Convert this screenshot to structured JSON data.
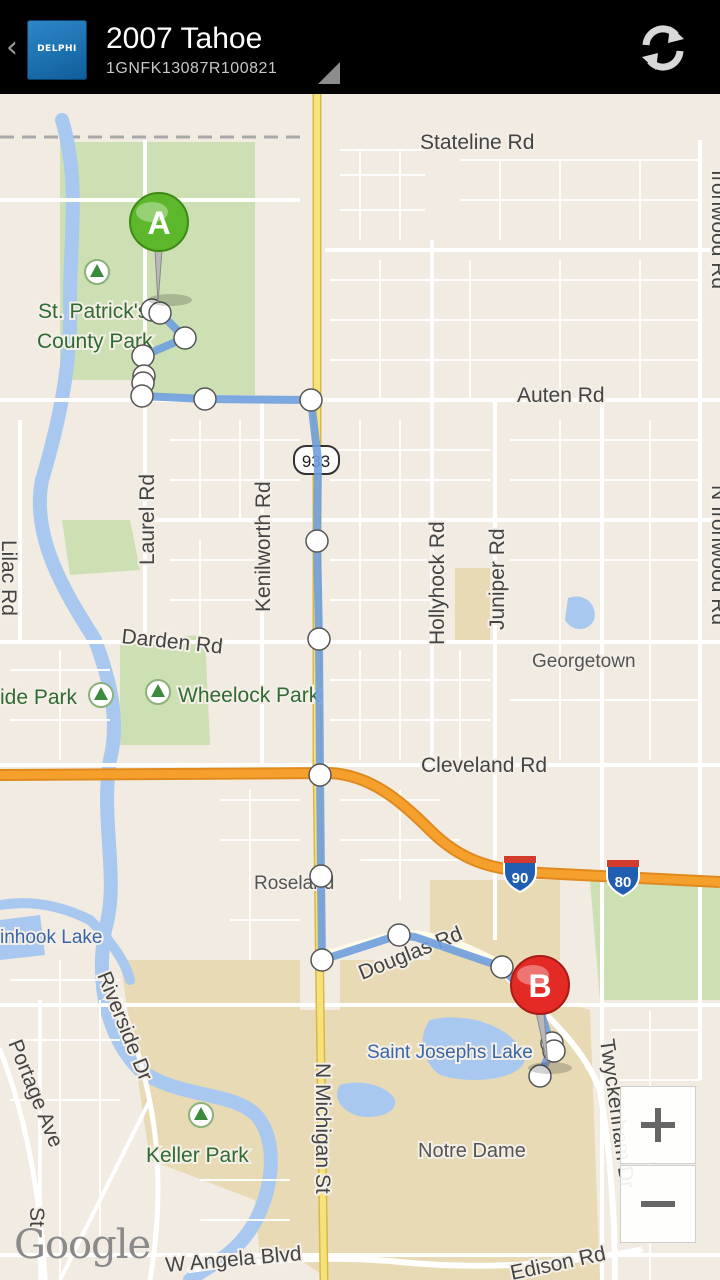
{
  "app": {
    "title": "2007 Tahoe",
    "vin": "1GNFK13087R100821",
    "logo_text": "DELPHI",
    "back_icon": "chevron-left-icon",
    "refresh_icon": "refresh-icon"
  },
  "map": {
    "attribution": "Google",
    "route_color": "#6f9fde",
    "interstate_color": "#f39c12",
    "roads": {
      "stateline": "Stateline Rd",
      "auten": "Auten Rd",
      "laurel": "Laurel Rd",
      "kenilworth": "Kenilworth Rd",
      "hollyhock": "Hollyhock Rd",
      "juniper": "Juniper Rd",
      "ironwood_top": "Ironwood Rd",
      "ironwood_mid": "N Ironwood Rd",
      "lilac": "Lilac Rd",
      "darden": "Darden Rd",
      "cleveland": "Cleveland Rd",
      "douglas": "Douglas Rd",
      "michigan": "N Michigan St",
      "riverside": "Riverside Dr",
      "portage": "Portage Ave",
      "twyckenham": "Twyckenham Dr",
      "angela": "W Angela Blvd",
      "edison": "Edison Rd",
      "left_bottom": "St"
    },
    "places": {
      "st_patrick": [
        "St. Patrick's",
        "County Park"
      ],
      "wheelock": "Wheelock Park",
      "ide_park": "ide Park",
      "georgetown": "Georgetown",
      "roseland": "Roseland",
      "chain_lake": "inhook Lake",
      "saint_josephs": "Saint Josephs Lake",
      "notre_dame": "Notre Dame",
      "keller": "Keller Park"
    },
    "shields": {
      "route933": "933",
      "i90": "90",
      "i80": "80"
    },
    "markers": {
      "start": "A",
      "end": "B"
    },
    "zoom_in": "+",
    "zoom_out": "−"
  }
}
